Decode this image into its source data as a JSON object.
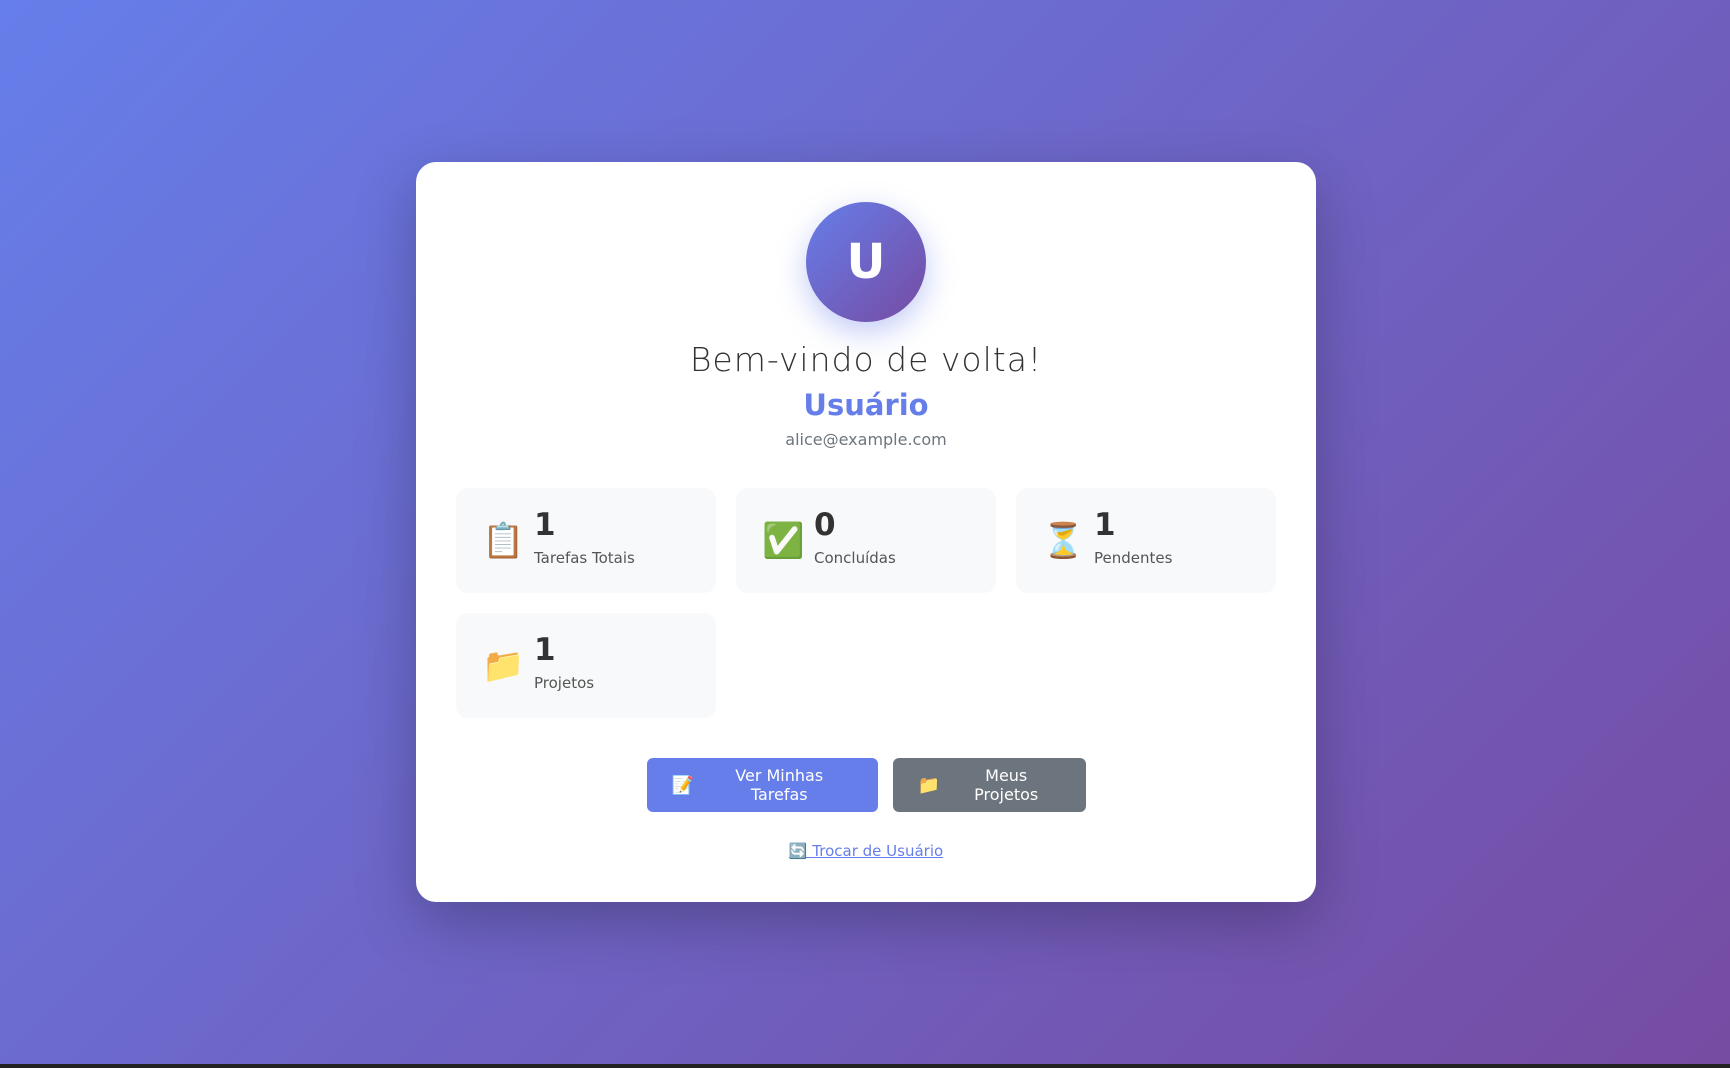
{
  "profile": {
    "avatar_initial": "U",
    "welcome": "Bem-vindo de volta!",
    "name": "Usuário",
    "email": "alice@example.com"
  },
  "stats": [
    {
      "icon": "📋",
      "icon_name": "clipboard-icon",
      "value": "1",
      "label": "Tarefas Totais"
    },
    {
      "icon": "✅",
      "icon_name": "check-icon",
      "value": "0",
      "label": "Concluídas"
    },
    {
      "icon": "⏳",
      "icon_name": "hourglass-icon",
      "value": "1",
      "label": "Pendentes"
    },
    {
      "icon": "📁",
      "icon_name": "folder-icon",
      "value": "1",
      "label": "Projetos"
    }
  ],
  "actions": {
    "tasks_icon": "📝",
    "tasks_label": "Ver Minhas Tarefas",
    "projects_icon": "📁",
    "projects_label": "Meus Projetos"
  },
  "switch_user": {
    "icon": "🔄",
    "label": "Trocar de Usuário"
  },
  "colors": {
    "accent": "#667eea",
    "gradient_end": "#764ba2",
    "secondary": "#6c757d"
  }
}
